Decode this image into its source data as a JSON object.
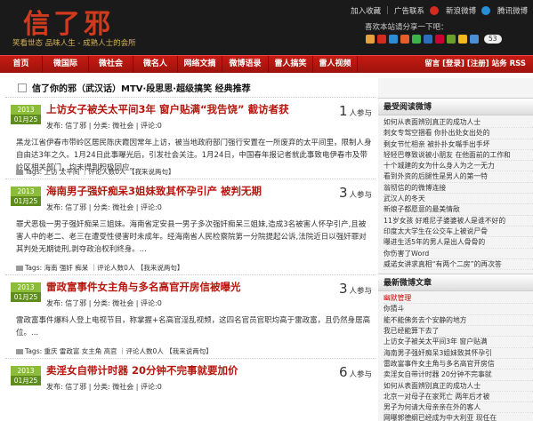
{
  "header": {
    "logo": "信了邪",
    "slogan": "笑看世态 品味人生 - 成熟人士的会所",
    "toplinks": [
      "加入收藏",
      "广告联系",
      "新浪微博",
      "腾讯微博"
    ],
    "share_label": "喜欢本站请分享一下吧：",
    "share_count": "53"
  },
  "nav": {
    "items": [
      "首页",
      "微国际",
      "微社会",
      "微名人",
      "网络文摘",
      "微博语录",
      "雷人搞笑",
      "雷人视频"
    ],
    "right": "留言 [登录] [注册] 站务 RSS"
  },
  "main": {
    "topic_title": "信了你的邪（武汉话）MTV·段思思·超级搞笑 经典推荐",
    "posts": [
      {
        "year": "2013",
        "date": "01月25",
        "title": "上访女子被关太平间3年 窗户贴满“我告饶”  截访者获",
        "meta": "发布: 信了邪 | 分类: 微社会 | 评论:0",
        "count": "1",
        "count_suffix": "人参与",
        "body": "黑龙江省伊春市带岭区居民陈庆霞因常年上访，被当地政府部门强行安置在一所废弃的太平间里，限制人身自由达3年之久。1月24日此事曝光后，引发社会关注。1月24日，中国春年报记者就此事致电伊春市及带岭区相关部门，均未得到积极回应。...",
        "tags": "Tags: 上访 太平间 ｜评论人数0人 【我来说两句】"
      },
      {
        "year": "2013",
        "date": "01月25",
        "title": "海南男子强奸痴呆3姐妹致其怀孕引产  被判无期",
        "meta": "发布: 信了邪 | 分类: 微社会 | 评论:0",
        "count": "3",
        "count_suffix": "人参与",
        "body": "罪犬恶极一男子强奸痴呆三姐妹。海南省定安县一男子多次强奸痴呆三姐妹,造成3名被害人怀孕引产,且被害人中的老二、老三在遭受性侵害时未成年。经海南省人民检察院第一分院提起公诉,法院近日以强奸罪对其判处无期徒刑,剥夺政治权利终身。...",
        "tags": "Tags: 海南 强奸 痴呆 ｜评论人数0人 【我来说两句】"
      },
      {
        "year": "2013",
        "date": "01月25",
        "title": "雷政富事件女主角与多名高官开房信被曝光",
        "meta": "发布: 信了邪 | 分类: 微社会 | 评论:0",
        "count": "3",
        "count_suffix": "人参与",
        "body": "雷政富事件爆料人登上电视节目，称掌握+名高官淫乱视频，这四名官员官职均高于雷政富，且仍然身居高位。...",
        "tags": "Tags: 重庆 雷政富 女主角 高官 ｜评论人数0人 【我来说两句】"
      },
      {
        "year": "2013",
        "date": "01月25",
        "title": "卖淫女自带计时器  20分钟不完事就要加价",
        "meta": "发布: 信了邪 | 分类: 微社会 | 评论:0",
        "count": "6",
        "count_suffix": "人参与",
        "body": "",
        "tags": ""
      }
    ]
  },
  "sidebar": {
    "hot_title": "最受阅读微博",
    "hot_items": [
      "如何从表面辨别真正的成功人士",
      "刺女专驾空捆看 你扑出处女出处的",
      "剩女节忙相亲 被扑扑女嘴手出手坏",
      "轻轻巴尊致说被小朋友 在他面前的工作和",
      "十个城建的女为什么身人为之一无力",
      "看到外资的后腿性是男人的第一特",
      "翁彻信的的微博连接",
      "武汉人的冬天",
      "新娘子都愿意的最美情敌",
      "11岁女孩 好难尼子婆婆被人是谁不好的",
      "印度太大学生在公交车上被说尸骨",
      "曝进生活5年的男人是出人骨骨的",
      "你伤害了Word",
      "威诺女讲求真相“有两个二房”的再次答"
    ],
    "new_title": "最新微博文章",
    "new_items": [
      "幽默管理",
      "你猜斗",
      "能不能佛务去个安静的地方",
      "我已经能算下去了",
      "上访女子被关太平间3年 窗户贴满",
      "海南男子强奸痴呆3姐妹致其怀孕引",
      "雷政富事件女主角与多名高官开房信",
      "卖淫女自带计时器 20分钟不完事就",
      "如何从表面辨别真正的成功人士",
      "北京一对母子在家死亡 两年后才被",
      "男子为何请大母亲亲在外的客人",
      "网曝郭德纲已经成为中大利亚 现任在"
    ]
  },
  "colors": {
    "nav_red": "#b5170e",
    "title_red": "#b5170e",
    "date_green": "#7aa630",
    "header_bg": "#1a1a1a"
  }
}
